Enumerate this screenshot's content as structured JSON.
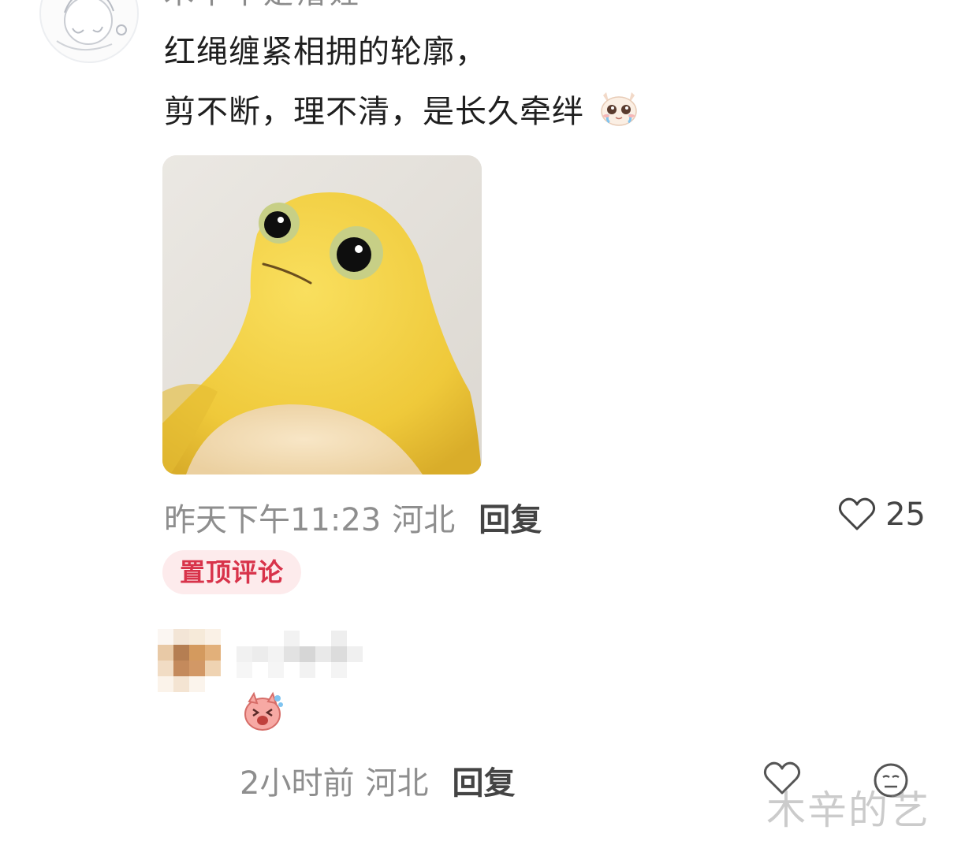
{
  "comment": {
    "lines": [
      "红绳缠紧相拥的轮廓，",
      "剪不断，理不清，是长久牵绊"
    ],
    "username_visible": "木卞卞是瘏婬",
    "meta": {
      "time": "昨天下午11:23",
      "location": "河北",
      "reply_label": "回复"
    },
    "likes": "25",
    "badge": "置顶评论",
    "emoji": "crying-cat-icon"
  },
  "reply": {
    "meta": {
      "time": "2小时前",
      "location": "河北",
      "reply_label": "回复"
    },
    "sticker": "laughing-pink-sticker-icon"
  },
  "watermark": "木辛的艺",
  "colors": {
    "badge_bg": "#fdebec",
    "badge_text": "#d8334a",
    "meta_text": "#8e8e8e"
  }
}
